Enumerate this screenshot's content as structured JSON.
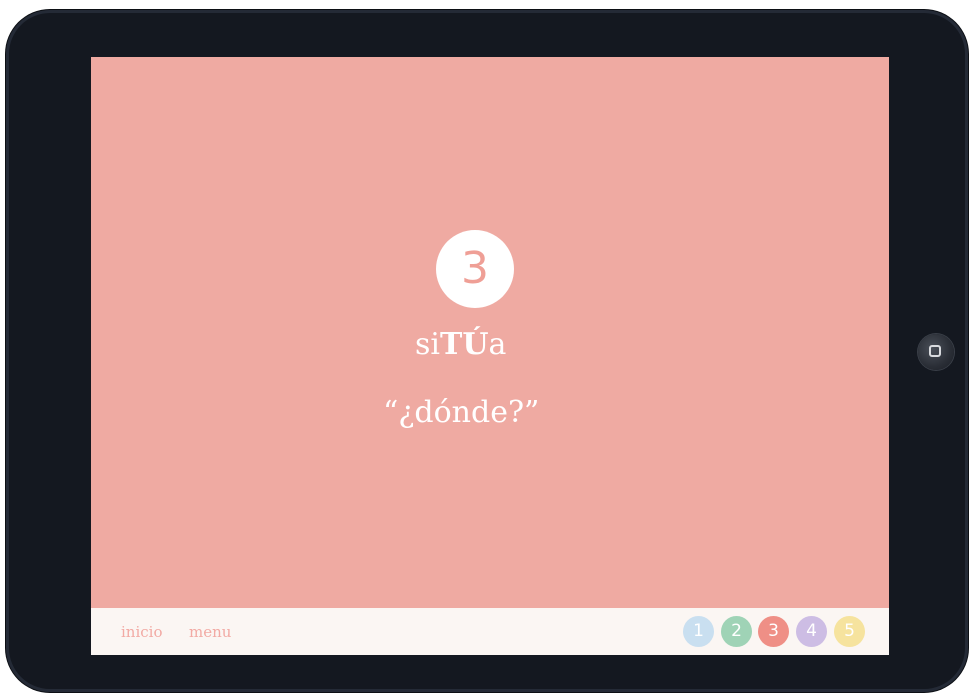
{
  "slide": {
    "number": "3",
    "title_pre": "si",
    "title_strong": "TÚ",
    "title_post": "a",
    "subtitle": "“¿dónde?”"
  },
  "bottom_bar": {
    "links": [
      {
        "label": "inicio"
      },
      {
        "label": "menu"
      }
    ],
    "pages": [
      {
        "label": "1",
        "color": "#c9dff0",
        "state": "default"
      },
      {
        "label": "2",
        "color": "#9fd3b6",
        "state": "default"
      },
      {
        "label": "3",
        "color": "#ef8f86",
        "state": "active"
      },
      {
        "label": "4",
        "color": "#cdbde4",
        "state": "default"
      },
      {
        "label": "5",
        "color": "#f6e39e",
        "state": "default"
      }
    ]
  },
  "colors": {
    "screen_background": "#efaaa2",
    "bottom_bar_background": "#fbf6f3",
    "link_color": "#f2aaa4",
    "device_frame": "#141820"
  }
}
